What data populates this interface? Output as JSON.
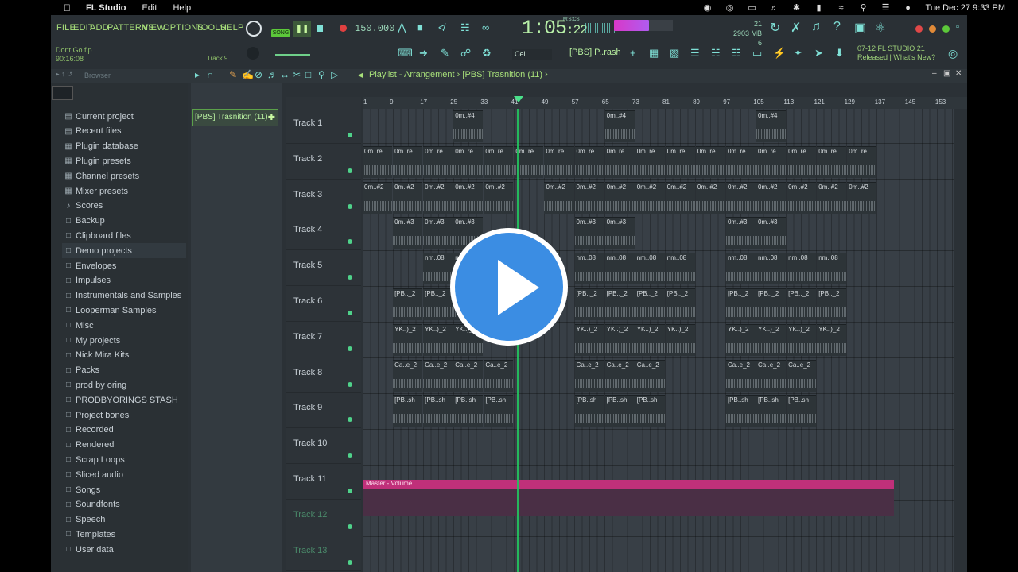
{
  "menubar": {
    "app_name": "FL Studio",
    "items": [
      "Edit",
      "Help"
    ],
    "clock": "Tue Dec 27  9:33 PM"
  },
  "fl_menu": [
    "FILE",
    "EDIT",
    "ADD",
    "PATTERNS",
    "VIEW",
    "OPTIONS",
    "TOOLS",
    "HELP"
  ],
  "transport": {
    "mode": "SONG",
    "tempo": "150.000",
    "time_main": "1:05",
    "time_sub": ":22",
    "time_label": "M:S:CS"
  },
  "memory": {
    "cpu": "21",
    "ram": "2903 MB",
    "poly": "6"
  },
  "hint": {
    "line1": "Dont Go.flp",
    "line2": "90:16:08",
    "track": "Track 9"
  },
  "snap": "Cell",
  "pattern_select": "[PBS] P..rash",
  "news": {
    "date": "07-12",
    "title": "FL STUDIO 21",
    "line2": "Released | What's New?"
  },
  "playlist": {
    "breadcrumb": "Playlist - Arrangement",
    "pattern": "[PBS] Trasnition (11)",
    "ruler": [
      "1",
      "9",
      "17",
      "25",
      "33",
      "41",
      "49",
      "57",
      "65",
      "73",
      "81",
      "89",
      "97",
      "105",
      "113",
      "121",
      "129",
      "137",
      "145",
      "153"
    ],
    "tracks": [
      "Track 1",
      "Track 2",
      "Track 3",
      "Track 4",
      "Track 5",
      "Track 6",
      "Track 7",
      "Track 8",
      "Track 9",
      "Track 10",
      "Track 11",
      "Track 12",
      "Track 13"
    ],
    "automation_label": "Master - Volume"
  },
  "browser": {
    "label": "Browser",
    "items": [
      "Current project",
      "Recent files",
      "Plugin database",
      "Plugin presets",
      "Channel presets",
      "Mixer presets",
      "Scores",
      "Backup",
      "Clipboard files",
      "Demo projects",
      "Envelopes",
      "Impulses",
      "Instrumentals and Samples",
      "Looperman Samples",
      "Misc",
      "My projects",
      "Nick Mira Kits",
      "Packs",
      "prod by oring",
      "PRODBYORINGS STASH",
      "Project bones",
      "Recorded",
      "Rendered",
      "Scrap Loops",
      "Sliced audio",
      "Songs",
      "Soundfonts",
      "Speech",
      "Templates",
      "User data"
    ],
    "selected": "Demo projects"
  },
  "clips": {
    "t1": "0m..#4",
    "t2": "0m..re",
    "t3": "0m..#2",
    "t4": "0m..#3",
    "t5": "nm..08",
    "t6": "[PB.._2",
    "t7": "YK..)_2",
    "t8": "Ca..e_2",
    "t9": "[PB..sh"
  },
  "colors": {
    "accent": "#a8e07a",
    "playhead": "#22c55e",
    "automation": "#c0307a",
    "play_overlay": "#3b8de3"
  }
}
